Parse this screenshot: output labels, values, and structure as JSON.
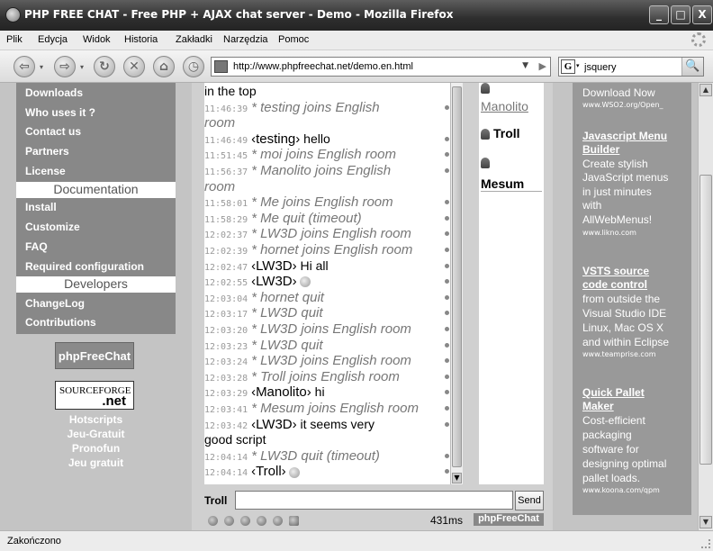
{
  "window": {
    "title": "PHP FREE CHAT - Free PHP + AJAX chat server - Demo - Mozilla Firefox",
    "minimize": "_",
    "maximize": "□",
    "close": "X"
  },
  "menu": [
    "Plik",
    "Edycja",
    "Widok",
    "Historia",
    "Zakładki",
    "Narzędzia",
    "Pomoc"
  ],
  "toolbar": {
    "back_icon": "⇦",
    "forward_icon": "⇨",
    "reload_icon": "↻",
    "stop_icon": "✕",
    "home_icon": "⌂",
    "history_icon": "◷",
    "url": "http://www.phpfreechat.net/demo.en.html",
    "url_dropdown": "▼",
    "go_icon": "▶",
    "search_engine": "G",
    "search_value": "jsquery",
    "search_icon": "🔍"
  },
  "leftnav": {
    "items_a": [
      "Downloads",
      "Who uses it ?",
      "Contact us",
      "Partners",
      "License"
    ],
    "heading_doc": "Documentation",
    "items_b": [
      "Install",
      "Customize",
      "FAQ",
      "Required configuration"
    ],
    "heading_dev": "Developers",
    "items_c": [
      "ChangeLog",
      "Contributions"
    ],
    "pfc_logo": "phpFreeChat",
    "sf_logo_a": "SOURCEFORGE",
    "sf_logo_b": ".net",
    "bottom_links": [
      "Hotscripts",
      "Jeu-Gratuit",
      "Pronofun",
      "Jeu gratuit"
    ]
  },
  "chat": {
    "messages": [
      {
        "time": "",
        "type": "cont",
        "text": "in the top"
      },
      {
        "time": "11:46:39",
        "type": "sys",
        "text": "* testing joins English"
      },
      {
        "time": "",
        "type": "cont-sys",
        "text": "room"
      },
      {
        "time": "11:46:49",
        "type": "msg",
        "nick": "testing",
        "text": " hello"
      },
      {
        "time": "11:51:45",
        "type": "sys",
        "text": "* moi joins English room"
      },
      {
        "time": "11:56:37",
        "type": "sys",
        "text": "* Manolito joins English"
      },
      {
        "time": "",
        "type": "cont-sys",
        "text": "room"
      },
      {
        "time": "11:58:01",
        "type": "sys",
        "text": "* Me joins English room"
      },
      {
        "time": "11:58:29",
        "type": "sys",
        "text": "* Me quit (timeout)"
      },
      {
        "time": "12:02:37",
        "type": "sys",
        "text": "* LW3D joins English room"
      },
      {
        "time": "12:02:39",
        "type": "sys",
        "text": "* hornet joins English room"
      },
      {
        "time": "12:02:47",
        "type": "msg",
        "nick": "LW3D",
        "text": " Hi all"
      },
      {
        "time": "12:02:55",
        "type": "msg",
        "nick": "LW3D",
        "text": "",
        "smile": true
      },
      {
        "time": "12:03:04",
        "type": "sys",
        "text": "* hornet quit"
      },
      {
        "time": "12:03:17",
        "type": "sys",
        "text": "* LW3D quit"
      },
      {
        "time": "12:03:20",
        "type": "sys",
        "text": "* LW3D joins English room"
      },
      {
        "time": "12:03:23",
        "type": "sys",
        "text": "* LW3D quit"
      },
      {
        "time": "12:03:24",
        "type": "sys",
        "text": "* LW3D joins English room"
      },
      {
        "time": "12:03:28",
        "type": "sys",
        "text": "* Troll joins English room"
      },
      {
        "time": "12:03:29",
        "type": "msg",
        "nick": "Manolito",
        "text": " hi"
      },
      {
        "time": "12:03:41",
        "type": "sys",
        "text": "* Mesum joins English room"
      },
      {
        "time": "12:03:42",
        "type": "msg",
        "nick": "LW3D",
        "text": " it seems very"
      },
      {
        "time": "",
        "type": "cont",
        "text": "good script"
      },
      {
        "time": "12:04:14",
        "type": "sys",
        "text": "* LW3D quit (timeout)"
      },
      {
        "time": "12:04:14",
        "type": "msg",
        "nick": "Troll",
        "text": "",
        "smile": true
      }
    ],
    "users": [
      "Manolito",
      "Troll",
      "Mesum"
    ],
    "nickname": "Troll",
    "input_value": "",
    "send_label": "Send",
    "ping": "431ms",
    "badge": "phpFreeChat"
  },
  "ads": [
    {
      "title": "",
      "body": [
        "Download Now"
      ],
      "url": "www.WSO2.org/Open_"
    },
    {
      "title_lines": [
        "Javascript Menu",
        "Builder"
      ],
      "body": [
        "Create stylish",
        "JavaScript menus",
        "in just minutes",
        "with",
        "AllWebMenus!"
      ],
      "url": "www.likno.com"
    },
    {
      "title_lines": [
        "VSTS source",
        "code control"
      ],
      "body": [
        "from outside the",
        "Visual Studio IDE",
        "Linux, Mac OS X",
        "and within Eclipse"
      ],
      "url": "www.teamprise.com"
    },
    {
      "title_lines": [
        "Quick Pallet",
        "Maker"
      ],
      "body": [
        "Cost-efficient",
        "packaging",
        "software for",
        "designing optimal",
        "pallet loads."
      ],
      "url": "www.koona.com/qpm"
    }
  ],
  "status": "Zakończono"
}
